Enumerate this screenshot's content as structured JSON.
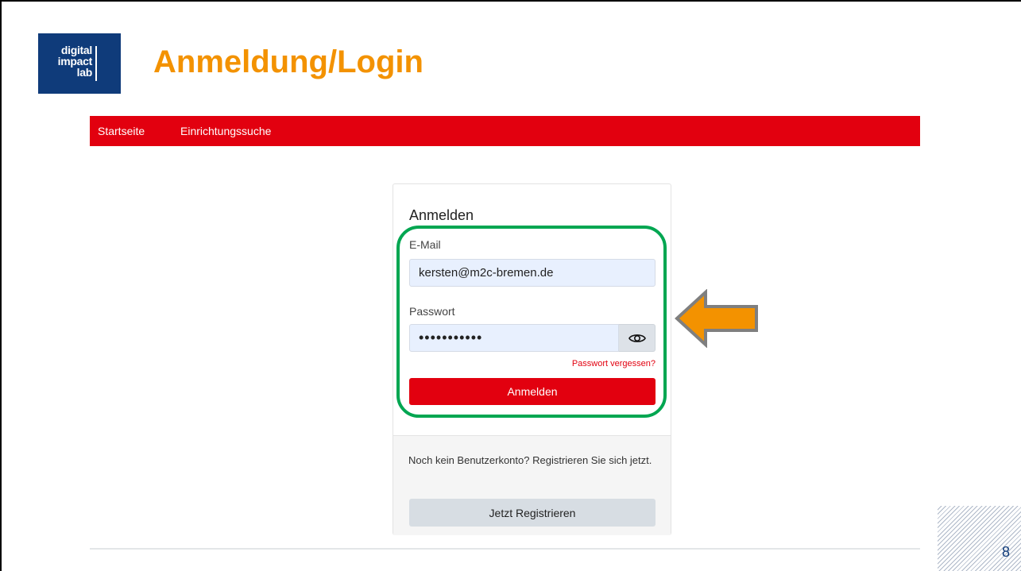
{
  "slide": {
    "title": "Anmeldung/Login",
    "logo_lines": [
      "digital",
      "impact",
      "lab"
    ],
    "page_number": "8"
  },
  "nav": {
    "items": [
      {
        "label": "Startseite"
      },
      {
        "label": "Einrichtungssuche"
      }
    ]
  },
  "login": {
    "heading": "Anmelden",
    "email_label": "E-Mail",
    "email_value": "kersten@m2c-bremen.de",
    "password_label": "Passwort",
    "password_value": "•••••••••••",
    "forgot_link": "Passwort vergessen?",
    "submit_label": "Anmelden"
  },
  "register": {
    "prompt": "Noch kein Benutzerkonto? Registrieren Sie sich jetzt.",
    "button_label": "Jetzt Registrieren"
  },
  "colors": {
    "brand_red": "#e2000f",
    "title_orange": "#f39200",
    "highlight_green": "#00a651",
    "logo_blue": "#0f3b7a"
  },
  "icons": {
    "show_password": "eye-icon",
    "annotation": "arrow-left-icon"
  }
}
